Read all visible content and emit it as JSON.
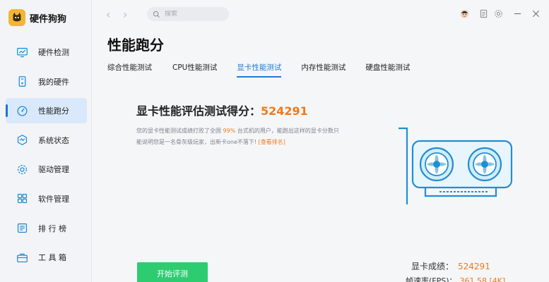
{
  "app": {
    "name": "硬件狗狗"
  },
  "sidebar": {
    "items": [
      {
        "label": "硬件检测",
        "icon": "monitor-chart-icon"
      },
      {
        "label": "我的硬件",
        "icon": "tower-pc-icon"
      },
      {
        "label": "性能跑分",
        "icon": "gauge-icon",
        "active": true
      },
      {
        "label": "系统状态",
        "icon": "status-hexagon-icon"
      },
      {
        "label": "驱动管理",
        "icon": "gear-icon"
      },
      {
        "label": "软件管理",
        "icon": "app-grid-icon"
      },
      {
        "label": "排 行 榜",
        "icon": "ranking-list-icon"
      },
      {
        "label": "工 具 箱",
        "icon": "toolbox-icon"
      }
    ]
  },
  "topbar": {
    "search_placeholder": "搜索",
    "icons": [
      "back-arrow-icon",
      "forward-arrow-icon",
      "search-icon",
      "avatar-icon",
      "document-icon",
      "settings-icon",
      "minimize-icon",
      "close-icon"
    ]
  },
  "main": {
    "title": "性能跑分",
    "tabs": [
      {
        "label": "综合性能测试"
      },
      {
        "label": "CPU性能测试"
      },
      {
        "label": "显卡性能测试",
        "active": true
      },
      {
        "label": "内存性能测试"
      },
      {
        "label": "硬盘性能测试"
      }
    ],
    "score_prefix": "显卡性能评估测试得分：",
    "score_value": "524291",
    "desc_part1": "您的显卡性能测试成绩打败了全国",
    "desc_pct": "99%",
    "desc_part2": "台式机的用户，能跑出这样的显卡分数只能说明您是一名骨灰级玩家，出新卡one不落下!",
    "desc_rank": "[查看排名]",
    "result_label": "显卡成绩：",
    "result_value": "524291",
    "fps_label": "帧速率(FPS)：",
    "fps_value": "361.58 [4K]",
    "start_button": "开始评测"
  },
  "colors": {
    "accent": "#1e7bd6",
    "highlight": "#f07a1c",
    "start": "#2ecc71",
    "gpu_line": "#1f8fd6",
    "gpu_fill": "#d3ecf9"
  }
}
